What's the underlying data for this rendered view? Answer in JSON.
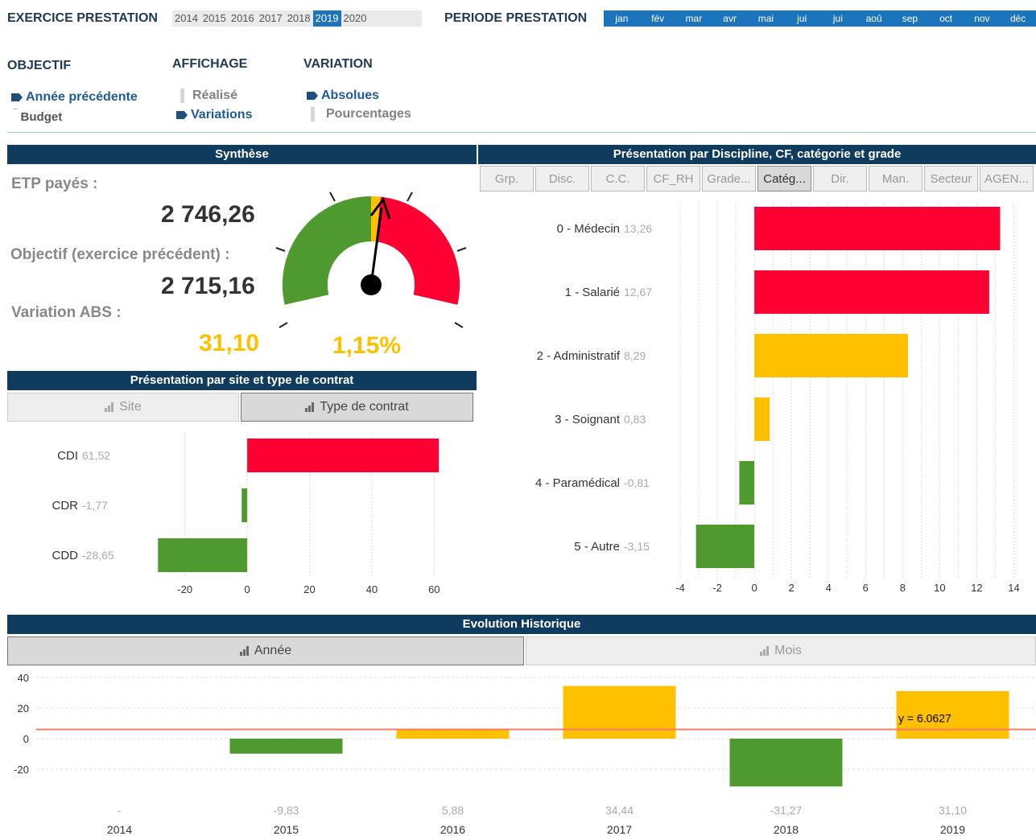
{
  "header": {
    "exercice_label": "EXERCICE PRESTATION",
    "years": [
      "2014",
      "2015",
      "2016",
      "2017",
      "2018",
      "2019",
      "2020"
    ],
    "selected_year": "2019",
    "periode_label": "PERIODE PRESTATION",
    "months": [
      "jan",
      "fév",
      "mar",
      "avr",
      "mai",
      "jui",
      "jui",
      "aoû",
      "sep",
      "oct",
      "nov",
      "déc"
    ]
  },
  "options": {
    "objectif": {
      "title": "OBJECTIF",
      "items": [
        "Année précédente",
        "Budget"
      ]
    },
    "affichage": {
      "title": "AFFICHAGE",
      "items": [
        "Réalisé",
        "Variations"
      ]
    },
    "variation": {
      "title": "VARIATION",
      "items": [
        "Absolues",
        "Pourcentages"
      ]
    }
  },
  "synthese": {
    "title": "Synthèse",
    "etp_label": "ETP payés :",
    "etp_value": "2 746,26",
    "objectif_label": "Objectif (exercice précédent) :",
    "objectif_value": "2 715,16",
    "variation_label": "Variation ABS :",
    "variation_abs": "31,10",
    "variation_pct": "1,15%",
    "accent_color": "#ffc000"
  },
  "site_panel": {
    "title": "Présentation par site et type de contrat",
    "tabs": [
      "Site",
      "Type de contrat"
    ],
    "selected_tab": "Type de contrat"
  },
  "discipline_panel": {
    "title": "Présentation par Discipline, CF, catégorie et grade",
    "tabs": [
      "Grp.",
      "Disc.",
      "C.C.",
      "CF_RH",
      "Grade...",
      "Catég...",
      "Dir.",
      "Man.",
      "Secteur",
      "AGEN..."
    ],
    "selected_tab": "Catég..."
  },
  "evolution_panel": {
    "title": "Evolution Historique",
    "tabs": [
      "Année",
      "Mois"
    ],
    "selected_tab": "Année",
    "trend_label": "y = 6.0627"
  },
  "colors": {
    "red": "#ff0033",
    "amber": "#ffc000",
    "green": "#4e9a2f",
    "navy": "#0f3b5f"
  },
  "chart_data": [
    {
      "type": "bar",
      "orientation": "horizontal",
      "categories": [
        "CDI",
        "CDR",
        "CDD"
      ],
      "values": [
        61.52,
        -1.77,
        -28.65
      ],
      "value_labels": [
        "61,52",
        "-1,77",
        "-28,65"
      ],
      "colors": [
        "#ff0033",
        "#4e9a2f",
        "#4e9a2f"
      ],
      "xlim": [
        -30,
        70
      ],
      "xticks": [
        -20,
        0,
        20,
        40,
        60
      ]
    },
    {
      "type": "bar",
      "orientation": "horizontal",
      "categories": [
        "0 - Médecin",
        "1 - Salarié",
        "2 - Administratif",
        "3 - Soignant",
        "4 - Paramédical",
        "5 - Autre"
      ],
      "values": [
        13.26,
        12.67,
        8.29,
        0.83,
        -0.81,
        -3.15
      ],
      "value_labels": [
        "13,26",
        "12,67",
        "8,29",
        "0,83",
        "-0,81",
        "-3,15"
      ],
      "colors": [
        "#ff0033",
        "#ff0033",
        "#ffc000",
        "#ffc000",
        "#4e9a2f",
        "#4e9a2f"
      ],
      "xlim": [
        -4,
        14.5
      ],
      "xticks": [
        -4,
        -2,
        0,
        2,
        4,
        6,
        8,
        10,
        12,
        14
      ]
    },
    {
      "type": "bar",
      "categories": [
        "2014",
        "2015",
        "2016",
        "2017",
        "2018",
        "2019"
      ],
      "values": [
        null,
        -9.83,
        5.88,
        34.44,
        -31.27,
        31.1
      ],
      "value_labels": [
        "-",
        "-9,83",
        "5,88",
        "34,44",
        "-31,27",
        "31,10"
      ],
      "colors": [
        "#4e9a2f",
        "#4e9a2f",
        "#ffc000",
        "#ffc000",
        "#4e9a2f",
        "#ffc000"
      ],
      "ylim": [
        -40,
        40
      ],
      "yticks": [
        40,
        20,
        0,
        -20
      ],
      "trend_y": 6.0627
    }
  ]
}
